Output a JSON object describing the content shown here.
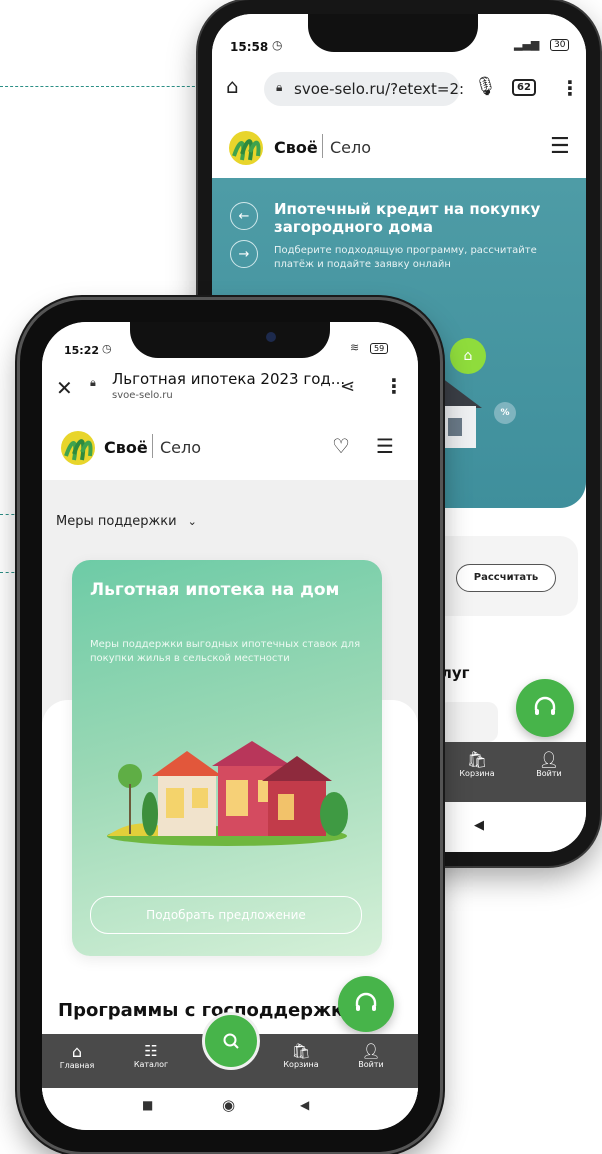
{
  "back_phone": {
    "status": {
      "time": "15:58",
      "battery": "30"
    },
    "browser": {
      "url": "svoe-selo.ru/?etext=2:",
      "tabs_count": "62"
    },
    "logo": {
      "brand": "Своё",
      "brand2": "Село"
    },
    "hero": {
      "title": "Ипотечный кредит на покупку загородного дома",
      "subtitle": "Подберите подходящую программу, рассчитайте платёж и подайте заявку онлайн"
    },
    "calc_button": "Рассчитать",
    "section_fragment": "слуг",
    "nav": {
      "cart": "Корзина",
      "login": "Войти"
    }
  },
  "front_phone": {
    "status": {
      "time": "15:22",
      "battery": "59"
    },
    "browser": {
      "title": "Льготная ипотека 2023 год...",
      "domain": "svoe-selo.ru"
    },
    "logo": {
      "brand": "Своё",
      "brand2": "Село"
    },
    "support_dropdown": "Меры поддержки",
    "card": {
      "title": "Льготная ипотека на дом",
      "subtitle": "Меры поддержки выгодных ипотечных ставок для покупки жилья в сельской местности",
      "button": "Подобрать предложение"
    },
    "programs_title": "Программы с господдержкой",
    "nav": {
      "home": "Главная",
      "catalog": "Каталог",
      "cart": "Корзина",
      "login": "Войти"
    }
  },
  "colors": {
    "brand_green": "#4cbb4a",
    "teal": "#4f9ea8",
    "card_green": "#86d4a9"
  }
}
